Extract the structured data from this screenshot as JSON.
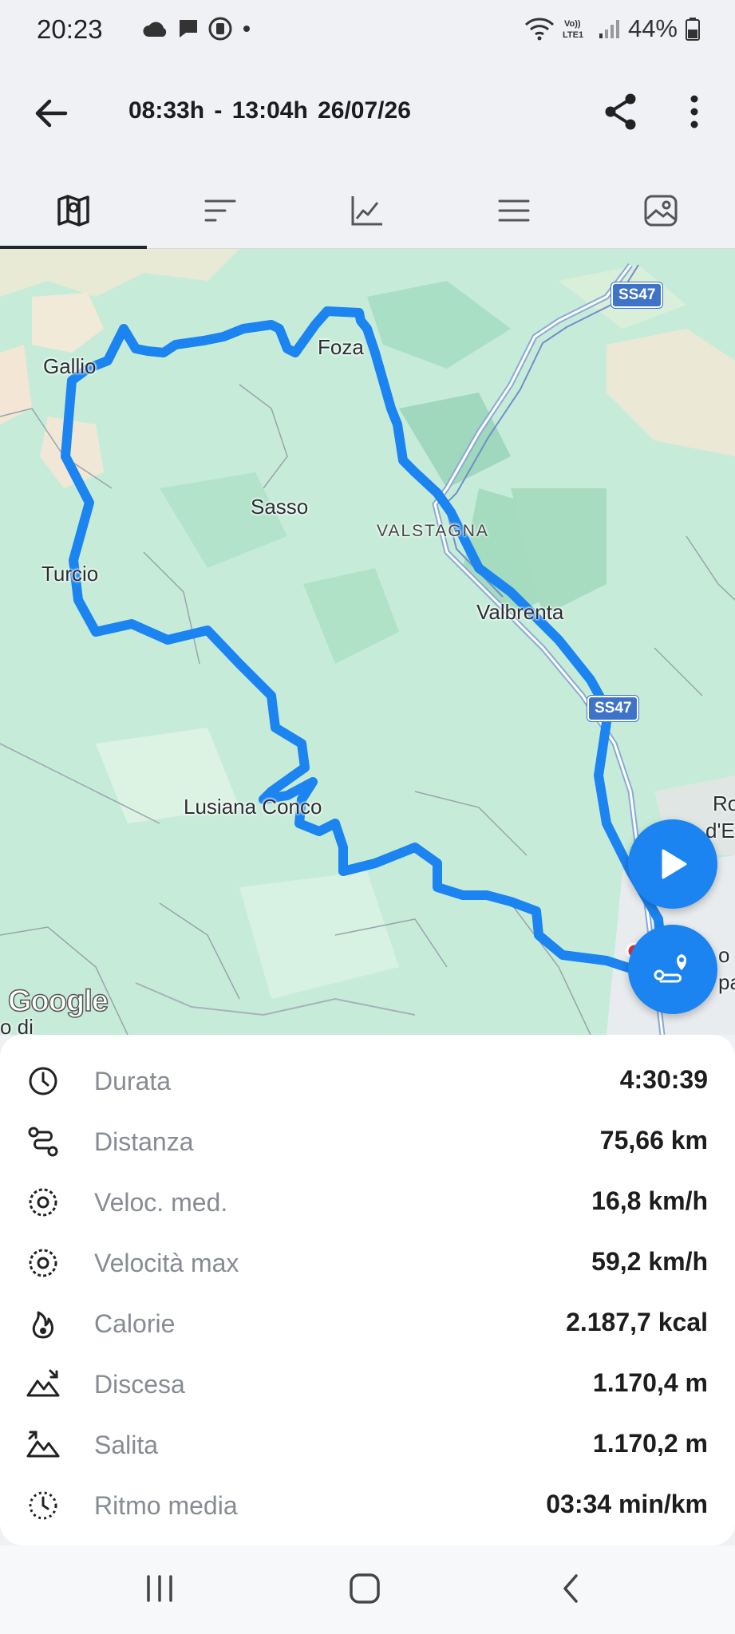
{
  "status_bar": {
    "time": "20:23",
    "network_label": "Vo))\nLTE1",
    "battery_text": "44%",
    "icons": [
      "cloud-icon",
      "message-icon",
      "sim-icon",
      "dot-icon",
      "wifi-icon",
      "signal-icon",
      "battery-icon"
    ]
  },
  "appbar": {
    "title": "08:33h - 13:04h   26/07/26",
    "icons": [
      "back-arrow-icon",
      "share-icon",
      "more-vert-icon"
    ]
  },
  "tabs": [
    {
      "name": "map",
      "icon": "map-icon",
      "active": true
    },
    {
      "name": "stats",
      "icon": "sort-lines-icon",
      "active": false
    },
    {
      "name": "chart",
      "icon": "line-chart-icon",
      "active": false
    },
    {
      "name": "list",
      "icon": "menu-icon",
      "active": false
    },
    {
      "name": "photos",
      "icon": "image-icon",
      "active": false
    }
  ],
  "map": {
    "places": {
      "gallio": "Gallio",
      "foza": "Foza",
      "sasso": "Sasso",
      "valstagna": "VALSTAGNA",
      "turcio": "Turcio",
      "valbrenta": "Valbrenta",
      "lusiana": "Lusiana Conco",
      "ro": "Ro",
      "de": "d'E",
      "odi": "o di",
      "o_right": "o",
      "pa": "pa"
    },
    "road_badges": [
      "SS47",
      "SS47"
    ],
    "attribution": "Google",
    "route_color": "#1b84f0"
  },
  "stats": [
    {
      "icon": "clock-icon",
      "label": "Durata",
      "value": "4:30:39"
    },
    {
      "icon": "route-icon",
      "label": "Distanza",
      "value": "75,66 km"
    },
    {
      "icon": "speedometer-icon",
      "label": "Veloc. med.",
      "value": "16,8 km/h"
    },
    {
      "icon": "speedometer-max-icon",
      "label": "Velocità max",
      "value": "59,2 km/h"
    },
    {
      "icon": "flame-icon",
      "label": "Calorie",
      "value": "2.187,7 kcal"
    },
    {
      "icon": "descent-icon",
      "label": "Discesa",
      "value": "1.170,4 m"
    },
    {
      "icon": "ascent-icon",
      "label": "Salita",
      "value": "1.170,2 m"
    },
    {
      "icon": "pace-icon",
      "label": "Ritmo media",
      "value": "03:34 min/km"
    }
  ],
  "navbar": {
    "icons": [
      "recent-apps-icon",
      "home-icon",
      "back-icon"
    ]
  }
}
